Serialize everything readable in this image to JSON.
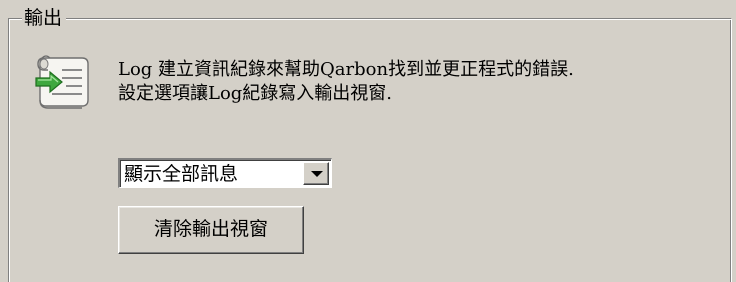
{
  "group": {
    "title": "輸出"
  },
  "description": {
    "line1": "Log 建立資訊紀錄來幫助Qarbon找到並更正程式的錯誤.",
    "line2": "設定選項讓Log紀錄寫入輸出視窗."
  },
  "log_level_select": {
    "selected": "顯示全部訊息"
  },
  "clear_button": {
    "label": "清除輸出視窗"
  },
  "icons": {
    "scroll": "scroll-with-arrow-icon",
    "dropdown": "chevron-down-icon"
  },
  "colors": {
    "window_bg": "#d4d0c8",
    "arrow_green": "#3fa83f"
  }
}
